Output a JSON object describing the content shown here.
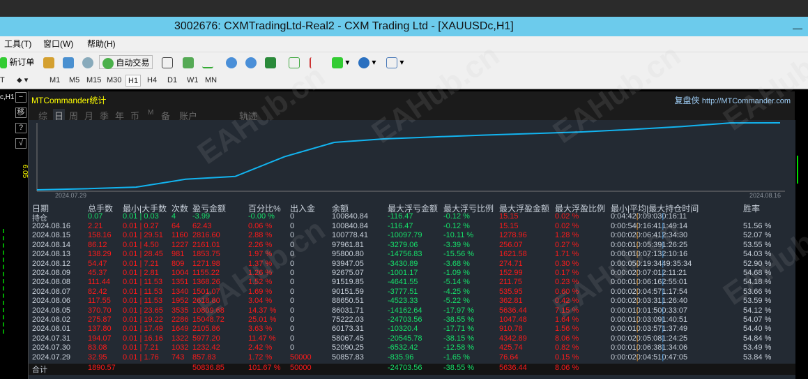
{
  "window": {
    "title": "3002676: CXMTradingLtd-Real2 - CXM Trading Ltd - [XAUUSDc,H1]",
    "minimize": "—"
  },
  "menu": [
    "工具(T)",
    "窗口(W)",
    "帮助(H)"
  ],
  "toolbar": {
    "new_order": "新订单",
    "auto_trading": "自动交易"
  },
  "timeframes": [
    "M1",
    "M5",
    "M15",
    "M30",
    "H1",
    "H4",
    "D1",
    "W1",
    "MN"
  ],
  "left": {
    "symbol": "c,H1",
    "buttons": [
      "−",
      "移",
      "?",
      "√"
    ],
    "price": "6.05"
  },
  "panel": {
    "title": "MTCommander统计",
    "brand": "复盘侠",
    "url": "http://MTCommander.com",
    "tabs": [
      "综",
      "日",
      "周",
      "月",
      "季",
      "年",
      "币",
      "M",
      "备",
      "账户",
      "轨迹"
    ],
    "chart_start": "2024.07.29",
    "chart_end": "2024.08.16"
  },
  "table": {
    "headers": [
      "日期",
      "总手数",
      "最小|大手数",
      "次数",
      "盈亏金额",
      "百分比%",
      "出入金",
      "余额",
      "最大浮亏金额",
      "最大浮亏比例",
      "最大浮盈金额",
      "最大浮盈比例",
      "最小|平均|最大持仓时间",
      "胜率"
    ],
    "open": {
      "date": "持仓",
      "lots": "0.07",
      "minmax": "0.01 | 0.03",
      "count": "4",
      "pnl": "-3.99",
      "pct": "-0.00 %",
      "deposit": "0",
      "balance": "100840.84",
      "maxdd": "-116.47",
      "maxddpct": "-0.12 %",
      "maxfp": "15.15",
      "maxfppct": "0.02 %",
      "time": "0:04:42 | 0:09:03 | 0:16:11",
      "win": ""
    },
    "rows": [
      [
        "2024.08.16",
        "2.21",
        "0.01 | 0.27",
        "64",
        "62.43",
        "0.06 %",
        "0",
        "100840.84",
        "-116.47",
        "-0.12 %",
        "15.15",
        "0.02 %",
        "0:00:54 | 0:16:41 | 1:49:14",
        "51.56 %"
      ],
      [
        "2024.08.15",
        "158.16",
        "0.01 | 29.51",
        "1160",
        "2816.60",
        "2.88 %",
        "0",
        "100778.41",
        "-10097.79",
        "-10.11 %",
        "1278.96",
        "1.28 %",
        "0:00:02 | 0:06:41 | 2:34:30",
        "52.07 %"
      ],
      [
        "2024.08.14",
        "86.12",
        "0.01 | 4.50",
        "1227",
        "2161.01",
        "2.26 %",
        "0",
        "97961.81",
        "-3279.06",
        "-3.39 %",
        "256.07",
        "0.27 %",
        "0:00:01 | 0:05:39 | 1:26:25",
        "53.55 %"
      ],
      [
        "2024.08.13",
        "138.29",
        "0.01 | 28.45",
        "981",
        "1853.75",
        "1.97 %",
        "0",
        "95800.80",
        "-14756.83",
        "-15.56 %",
        "1621.58",
        "1.71 %",
        "0:00:01 | 0:07:13 | 2:10:16",
        "54.03 %"
      ],
      [
        "2024.08.12",
        "54.47",
        "0.01 | 7.21",
        "809",
        "1271.98",
        "1.37 %",
        "0",
        "93947.05",
        "-3430.89",
        "-3.68 %",
        "274.71",
        "0.30 %",
        "0:00:05 | 0:19:34 | 49:35:34",
        "52.90 %"
      ],
      [
        "2024.08.09",
        "45.37",
        "0.01 | 2.81",
        "1004",
        "1155.22",
        "1.26 %",
        "0",
        "92675.07",
        "-1001.17",
        "-1.09 %",
        "152.99",
        "0.17 %",
        "0:00:02 | 0:07:01 | 2:11:21",
        "54.68 %"
      ],
      [
        "2024.08.08",
        "111.44",
        "0.01 | 11.53",
        "1351",
        "1368.26",
        "1.52 %",
        "0",
        "91519.85",
        "-4641.55",
        "-5.14 %",
        "211.75",
        "0.23 %",
        "0:00:01 | 0:06:16 | 2:55:01",
        "54.18 %"
      ],
      [
        "2024.08.07",
        "82.42",
        "0.01 | 11.53",
        "1340",
        "1501.07",
        "1.69 %",
        "0",
        "90151.59",
        "-3777.51",
        "-4.25 %",
        "535.95",
        "0.60 %",
        "0:00:02 | 0:04:57 | 1:17:54",
        "53.66 %"
      ],
      [
        "2024.08.06",
        "117.55",
        "0.01 | 11.53",
        "1952",
        "2618.80",
        "3.04 %",
        "0",
        "88650.51",
        "-4523.33",
        "-5.22 %",
        "362.81",
        "0.42 %",
        "0:00:02 | 0:03:31 | 1:26:40",
        "53.59 %"
      ],
      [
        "2024.08.05",
        "370.70",
        "0.01 | 23.65",
        "3535",
        "10809.68",
        "14.37 %",
        "0",
        "86031.71",
        "-14162.64",
        "-17.97 %",
        "5636.44",
        "7.15 %",
        "0:00:01 | 0:01:50 | 0:33:07",
        "54.12 %"
      ],
      [
        "2024.08.02",
        "275.87",
        "0.01 | 19.22",
        "2286",
        "15048.72",
        "25.01 %",
        "0",
        "75222.03",
        "-24703.56",
        "-38.55 %",
        "1047.48",
        "1.64 %",
        "0:00:01 | 0:03:09 | 1:40:51",
        "54.07 %"
      ],
      [
        "2024.08.01",
        "137.80",
        "0.01 | 17.49",
        "1649",
        "2105.86",
        "3.63 %",
        "0",
        "60173.31",
        "-10320.4",
        "-17.71 %",
        "910.78",
        "1.56 %",
        "0:00:01 | 0:03:57 | 1:37:49",
        "54.40 %"
      ],
      [
        "2024.07.31",
        "194.07",
        "0.01 | 16.16",
        "1322",
        "5977.20",
        "11.47 %",
        "0",
        "58067.45",
        "-20545.78",
        "-38.15 %",
        "4342.89",
        "8.06 %",
        "0:00:02 | 0:05:08 | 1:24:25",
        "54.84 %"
      ],
      [
        "2024.07.30",
        "83.08",
        "0.01 | 7.21",
        "1032",
        "1232.42",
        "2.42 %",
        "0",
        "52090.25",
        "-6532.42",
        "-12.58 %",
        "425.74",
        "0.82 %",
        "0:00:01 | 0:06:38 | 1:34:06",
        "53.49 %"
      ],
      [
        "2024.07.29",
        "32.95",
        "0.01 | 1.76",
        "743",
        "857.83",
        "1.72 %",
        "50000",
        "50857.83",
        "-835.96",
        "-1.65 %",
        "76.64",
        "0.15 %",
        "0:00:02 | 0:04:51 | 0:47:05",
        "53.84 %"
      ]
    ],
    "total": {
      "date": "合计",
      "lots": "1890.57",
      "pnl": "50836.85",
      "pct": "101.67 %",
      "deposit": "50000",
      "maxdd": "-24703.56",
      "maxddpct": "-38.55 %",
      "maxfp": "5636.44",
      "maxfppct": "8.06 %"
    }
  },
  "colors": {
    "equity_line": "#12b4f0",
    "loss": "#ff1a1a",
    "gain": "#16e06a"
  }
}
